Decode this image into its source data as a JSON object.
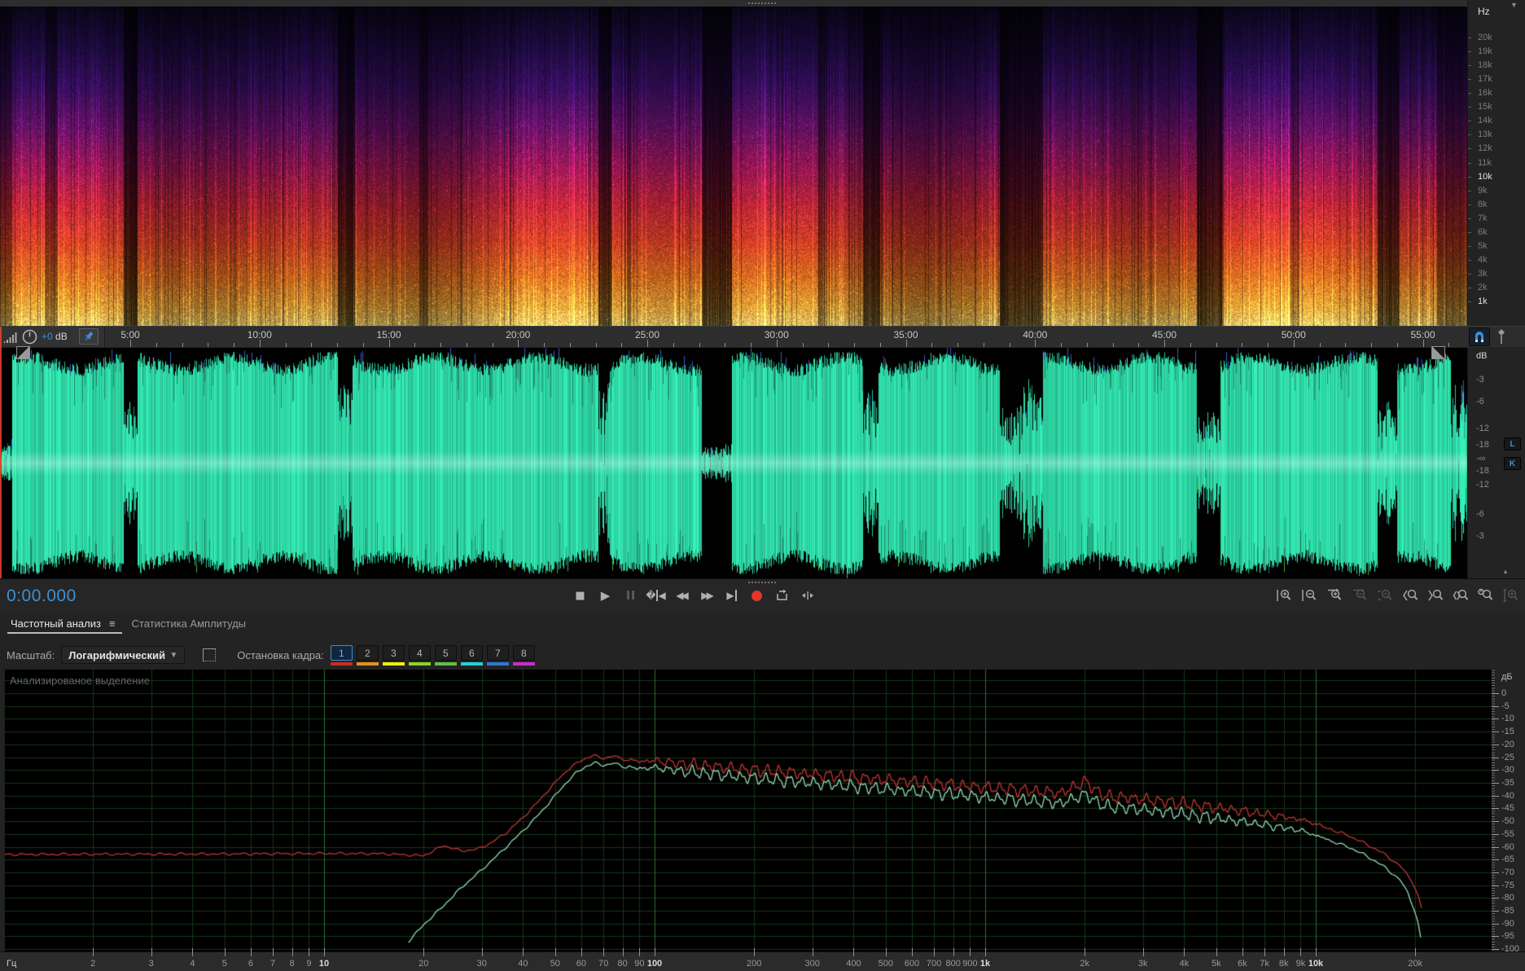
{
  "spectrogram": {
    "unit": "Hz",
    "freq_labels": [
      "20k",
      "19k",
      "18k",
      "17k",
      "16k",
      "15k",
      "14k",
      "13k",
      "12k",
      "11k",
      "10k",
      "9k",
      "8k",
      "7k",
      "6k",
      "5k",
      "4k",
      "3k",
      "2k",
      "1k"
    ],
    "bold_labels": [
      "10k",
      "1k"
    ]
  },
  "timeline": {
    "gain_value": "+0",
    "gain_unit": "dB",
    "time_labels": [
      "5:00",
      "10:00",
      "15:00",
      "20:00",
      "25:00",
      "30:00",
      "35:00",
      "40:00",
      "45:00",
      "50:00",
      "55:00"
    ]
  },
  "waveform": {
    "unit": "dB",
    "db_labels": [
      "-3",
      "-6",
      "-12",
      "-18",
      "-∞",
      "-18",
      "-12",
      "-6",
      "-3"
    ],
    "channel_buttons": [
      "L",
      "K"
    ],
    "wave_color": "#2fd6a4"
  },
  "transport": {
    "time_display": "0:00.000",
    "buttons": [
      "stop",
      "play",
      "pause",
      "skip-to-start",
      "rewind",
      "fast-forward",
      "skip-to-end",
      "record",
      "loop-playback",
      "skip-selection"
    ],
    "record_color": "#df372c"
  },
  "zoom_toolbar": {
    "buttons": [
      {
        "name": "zoom-in-amplitude",
        "enabled": true,
        "sign": "+",
        "deco": "v"
      },
      {
        "name": "zoom-out-amplitude",
        "enabled": true,
        "sign": "-",
        "deco": "v"
      },
      {
        "name": "zoom-in-time",
        "enabled": true,
        "sign": "+",
        "deco": "h"
      },
      {
        "name": "zoom-out-time",
        "enabled": false,
        "sign": "-",
        "deco": "h"
      },
      {
        "name": "zoom-reset",
        "enabled": false,
        "sign": "-",
        "deco": "a"
      },
      {
        "name": "zoom-selection-in-point",
        "enabled": true,
        "sign": "",
        "deco": "l"
      },
      {
        "name": "zoom-selection-out-point",
        "enabled": true,
        "sign": "",
        "deco": "r"
      },
      {
        "name": "zoom-selection",
        "enabled": true,
        "sign": "",
        "deco": "b"
      },
      {
        "name": "zoom-duration",
        "enabled": true,
        "sign": "",
        "deco": "t"
      },
      {
        "name": "zoom-full",
        "enabled": false,
        "sign": "+",
        "deco": "f"
      }
    ]
  },
  "analysis_panel": {
    "tabs": [
      {
        "label": "Частотный анализ",
        "active": true
      },
      {
        "label": "Статистика Амплитуды",
        "active": false
      }
    ],
    "scale_label": "Масштаб:",
    "scale_value": "Логарифмический",
    "hold_label": "Остановка кадра:",
    "hold_buttons": [
      {
        "label": "1",
        "color": "#cf2a21",
        "active": true
      },
      {
        "label": "2",
        "color": "#e2901c",
        "active": false
      },
      {
        "label": "3",
        "color": "#eeee14",
        "active": false
      },
      {
        "label": "4",
        "color": "#8ed32e",
        "active": false
      },
      {
        "label": "5",
        "color": "#63bf4a",
        "active": false
      },
      {
        "label": "6",
        "color": "#28cfd4",
        "active": false
      },
      {
        "label": "7",
        "color": "#2f78d4",
        "active": false
      },
      {
        "label": "8",
        "color": "#cb2ccb",
        "active": false
      }
    ],
    "overlay_label": "Анализированое выделение"
  },
  "chart_data": {
    "type": "line",
    "title": "Частотный анализ",
    "xlabel": "Гц",
    "ylabel": "дБ",
    "x_scale": "log",
    "x_range_hz": [
      1,
      33000
    ],
    "y_range_db": [
      -100,
      0
    ],
    "grid": true,
    "x_ticks": [
      {
        "f": 2,
        "label": "2"
      },
      {
        "f": 3,
        "label": "3"
      },
      {
        "f": 4,
        "label": "4"
      },
      {
        "f": 5,
        "label": "5"
      },
      {
        "f": 6,
        "label": "6"
      },
      {
        "f": 7,
        "label": "7"
      },
      {
        "f": 8,
        "label": "8"
      },
      {
        "f": 9,
        "label": "9"
      },
      {
        "f": 10,
        "label": "10",
        "bold": true
      },
      {
        "f": 20,
        "label": "20"
      },
      {
        "f": 30,
        "label": "30"
      },
      {
        "f": 40,
        "label": "40"
      },
      {
        "f": 50,
        "label": "50"
      },
      {
        "f": 60,
        "label": "60"
      },
      {
        "f": 70,
        "label": "70"
      },
      {
        "f": 80,
        "label": "80"
      },
      {
        "f": 90,
        "label": "90"
      },
      {
        "f": 100,
        "label": "100",
        "bold": true
      },
      {
        "f": 200,
        "label": "200"
      },
      {
        "f": 300,
        "label": "300"
      },
      {
        "f": 400,
        "label": "400"
      },
      {
        "f": 500,
        "label": "500"
      },
      {
        "f": 600,
        "label": "600"
      },
      {
        "f": 700,
        "label": "700"
      },
      {
        "f": 800,
        "label": "800"
      },
      {
        "f": 900,
        "label": "900"
      },
      {
        "f": 1000,
        "label": "1k",
        "bold": true
      },
      {
        "f": 2000,
        "label": "2k"
      },
      {
        "f": 3000,
        "label": "3k"
      },
      {
        "f": 4000,
        "label": "4k"
      },
      {
        "f": 5000,
        "label": "5k"
      },
      {
        "f": 6000,
        "label": "6k"
      },
      {
        "f": 7000,
        "label": "7k"
      },
      {
        "f": 8000,
        "label": "8k"
      },
      {
        "f": 9000,
        "label": "9k"
      },
      {
        "f": 10000,
        "label": "10k",
        "bold": true
      },
      {
        "f": 20000,
        "label": "20k"
      }
    ],
    "y_tick_labels": [
      "0",
      "-5",
      "-10",
      "-15",
      "-20",
      "-25",
      "-30",
      "-35",
      "-40",
      "-45",
      "-50",
      "-55",
      "-60",
      "-65",
      "-70",
      "-75",
      "-80",
      "-85",
      "-90",
      "-95",
      "-100"
    ],
    "series": [
      {
        "name": "red-curve",
        "color": "#c23531",
        "points": [
          [
            1,
            -63
          ],
          [
            5,
            -62.8
          ],
          [
            10,
            -62.6
          ],
          [
            15,
            -62.7
          ],
          [
            20,
            -63.5
          ],
          [
            23,
            -59.5
          ],
          [
            26,
            -61.6
          ],
          [
            29,
            -61
          ],
          [
            32,
            -58.5
          ],
          [
            36,
            -54
          ],
          [
            40,
            -48.5
          ],
          [
            44,
            -43
          ],
          [
            48,
            -37.5
          ],
          [
            52,
            -32.5
          ],
          [
            56,
            -28.8
          ],
          [
            60,
            -26.2
          ],
          [
            65,
            -24.3
          ],
          [
            70,
            -25.4
          ],
          [
            75,
            -24.6
          ],
          [
            82,
            -26
          ],
          [
            90,
            -26.6
          ],
          [
            100,
            -26.3
          ],
          [
            120,
            -27.5
          ],
          [
            150,
            -28.6
          ],
          [
            200,
            -30
          ],
          [
            260,
            -31
          ],
          [
            340,
            -32.2
          ],
          [
            450,
            -33.4
          ],
          [
            600,
            -34.6
          ],
          [
            800,
            -35.8
          ],
          [
            1000,
            -36.8
          ],
          [
            1300,
            -37.9
          ],
          [
            1700,
            -39
          ],
          [
            2000,
            -34.5
          ],
          [
            2300,
            -40.3
          ],
          [
            2800,
            -41
          ],
          [
            3600,
            -42.5
          ],
          [
            4700,
            -44.3
          ],
          [
            6000,
            -46
          ],
          [
            7500,
            -47.8
          ],
          [
            9000,
            -49.3
          ],
          [
            10000,
            -51
          ],
          [
            11000,
            -53
          ],
          [
            12500,
            -55.5
          ],
          [
            14000,
            -58.5
          ],
          [
            16000,
            -62.5
          ],
          [
            18000,
            -67.5
          ],
          [
            19500,
            -73
          ],
          [
            20500,
            -80
          ],
          [
            21000,
            -85
          ]
        ]
      },
      {
        "name": "green-curve",
        "color": "#93dbb4",
        "points": [
          [
            18,
            -97
          ],
          [
            20,
            -90.5
          ],
          [
            23,
            -83
          ],
          [
            26,
            -76
          ],
          [
            30,
            -69
          ],
          [
            34,
            -62.5
          ],
          [
            38,
            -56.5
          ],
          [
            42,
            -51
          ],
          [
            46,
            -45.5
          ],
          [
            50,
            -40
          ],
          [
            54,
            -35
          ],
          [
            58,
            -31
          ],
          [
            62,
            -28.6
          ],
          [
            66,
            -27.2
          ],
          [
            70,
            -28.2
          ],
          [
            75,
            -27.4
          ],
          [
            82,
            -28.8
          ],
          [
            90,
            -29.4
          ],
          [
            100,
            -29
          ],
          [
            120,
            -30.4
          ],
          [
            150,
            -31.6
          ],
          [
            200,
            -33.2
          ],
          [
            260,
            -34.4
          ],
          [
            340,
            -35.7
          ],
          [
            450,
            -37
          ],
          [
            600,
            -38.3
          ],
          [
            800,
            -39.5
          ],
          [
            1000,
            -40.6
          ],
          [
            1300,
            -41.8
          ],
          [
            1700,
            -43
          ],
          [
            2000,
            -39.5
          ],
          [
            2300,
            -44.2
          ],
          [
            2800,
            -45
          ],
          [
            3600,
            -46.6
          ],
          [
            4700,
            -48.4
          ],
          [
            6000,
            -50.2
          ],
          [
            7500,
            -52
          ],
          [
            9000,
            -53.6
          ],
          [
            10000,
            -55.5
          ],
          [
            11000,
            -57.5
          ],
          [
            12500,
            -60
          ],
          [
            14000,
            -63
          ],
          [
            16000,
            -67.5
          ],
          [
            18000,
            -73
          ],
          [
            19000,
            -78
          ],
          [
            19800,
            -84
          ],
          [
            20400,
            -90
          ],
          [
            20800,
            -96
          ]
        ]
      }
    ],
    "ripple": {
      "from_hz": 95,
      "to_hz": 9500,
      "amplitude_db": 2.3,
      "wavelength_decades": 0.037
    }
  }
}
